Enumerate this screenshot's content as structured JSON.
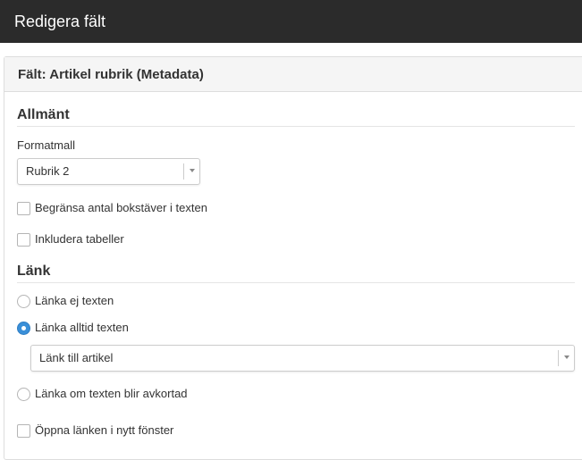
{
  "window": {
    "title": "Redigera fält"
  },
  "panel": {
    "heading": "Fält: Artikel rubrik (Metadata)"
  },
  "general": {
    "title": "Allmänt",
    "style_label": "Formatmall",
    "style_value": "Rubrik 2",
    "limit_chars_label": "Begränsa antal bokstäver i texten",
    "limit_chars_checked": false,
    "include_tables_label": "Inkludera tabeller",
    "include_tables_checked": false
  },
  "link": {
    "title": "Länk",
    "options": [
      {
        "label": "Länka ej texten",
        "checked": false
      },
      {
        "label": "Länka alltid texten",
        "checked": true
      },
      {
        "label": "Länka om texten blir avkortad",
        "checked": false
      }
    ],
    "target_value": "Länk till artikel",
    "new_window_label": "Öppna länken i nytt fönster",
    "new_window_checked": false
  },
  "colors": {
    "topbar": "#2b2b2b",
    "radio_selected": "#3a8fd8"
  },
  "icons": {
    "caret": "chevron-down-icon"
  }
}
